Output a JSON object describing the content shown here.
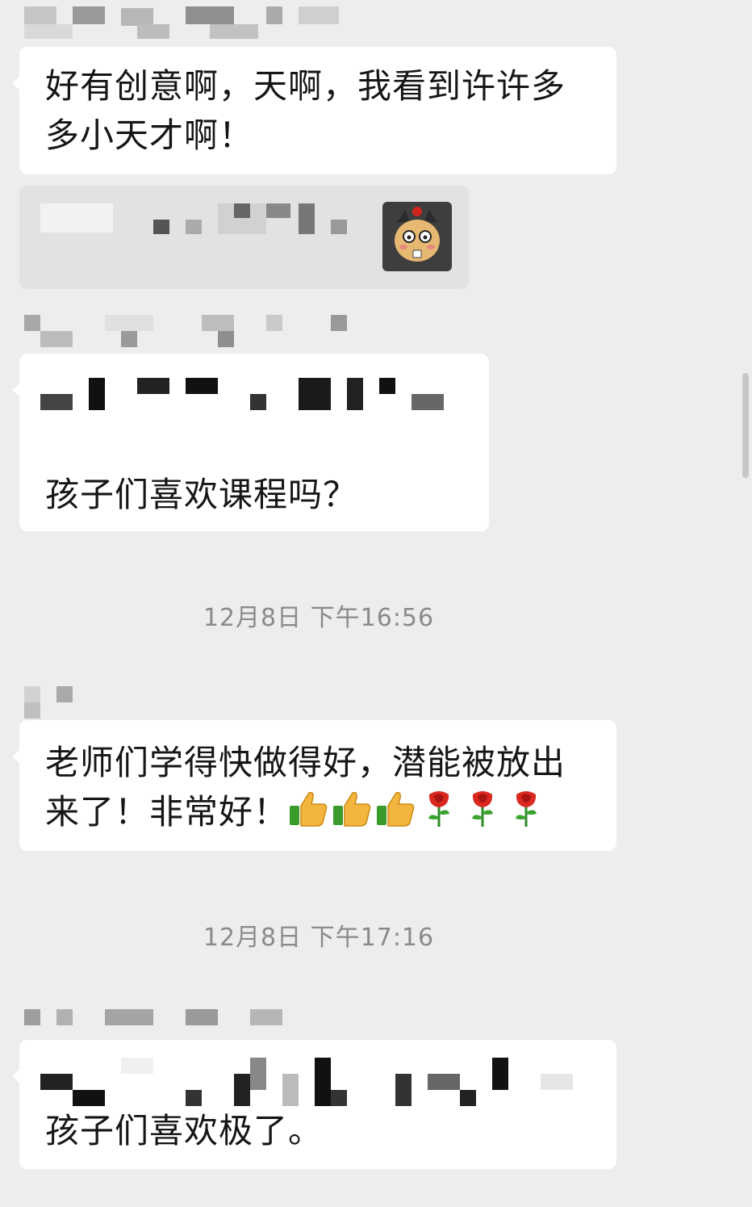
{
  "messages": [
    {
      "type": "text",
      "text": "好有创意啊，天啊，我看到许许多多小天才啊！"
    },
    {
      "type": "quote_image",
      "image_icon": "cartoon-avatar-icon"
    },
    {
      "type": "text",
      "text": "孩子们喜欢课程吗？"
    },
    {
      "type": "timestamp",
      "text": "12月8日 下午16:56"
    },
    {
      "type": "text",
      "text": "老师们学得快做得好，潜能被放出来了！非常好！",
      "emoji": [
        "thumbs-up-icon",
        "thumbs-up-icon",
        "thumbs-up-icon",
        "rose-icon",
        "rose-icon",
        "rose-icon"
      ]
    },
    {
      "type": "timestamp",
      "text": "12月8日 下午17:16"
    },
    {
      "type": "text",
      "text": "孩子们喜欢极了。"
    }
  ],
  "colors": {
    "background": "#ededed",
    "bubble": "#ffffff",
    "quote_bubble": "#e2e2e2",
    "timestamp": "#8a8a8a"
  }
}
